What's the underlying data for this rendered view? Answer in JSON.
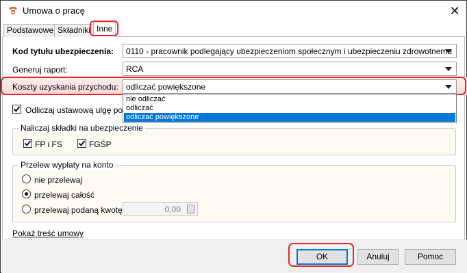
{
  "window": {
    "title": "Umowa o pracę",
    "close_symbol": "✕"
  },
  "tabs": [
    {
      "label": "Podstawowe"
    },
    {
      "label": "Składniki"
    },
    {
      "label": "Inne"
    }
  ],
  "form": {
    "kod_tytulu": {
      "label": "Kod tytułu ubezpieczenia:",
      "value": "0110 - pracownik podlegający ubezpieczeniom społecznym i ubezpieczeniu zdrowotnemu"
    },
    "generuj_raport": {
      "label": "Generuj raport:",
      "value": "RCA"
    },
    "koszty": {
      "label": "Koszty uzyskania przychodu:",
      "value": "odliczać powiększone",
      "options": [
        "nie odliczać",
        "odliczać",
        "odliczać powiększone"
      ],
      "selected_index": 2
    },
    "ulga": {
      "label": "Odliczaj ustawową ulgę podat",
      "checked": true
    },
    "skladki_group": {
      "title": "Naliczaj składki na ubezpieczenie",
      "fp_fs": {
        "label": "FP i FS",
        "checked": true
      },
      "fgsp": {
        "label": "FGŚP",
        "checked": true
      }
    },
    "przelew_group": {
      "title": "Przelew wypłaty na konto",
      "options": [
        {
          "label": "nie przelewaj",
          "selected": false
        },
        {
          "label": "przelewaj całość",
          "selected": true
        },
        {
          "label": "przelewaj podaną kwotę",
          "selected": false
        }
      ],
      "amount": "0,00"
    },
    "show_contract_link": "Pokaż treść umowy"
  },
  "footer": {
    "ok_label": "OK",
    "cancel_label": "Anuluj",
    "help_label": "Pomoc"
  },
  "colors": {
    "highlight": "#e8262a",
    "selection": "#0078d7",
    "default_button_border": "#0078d7"
  }
}
